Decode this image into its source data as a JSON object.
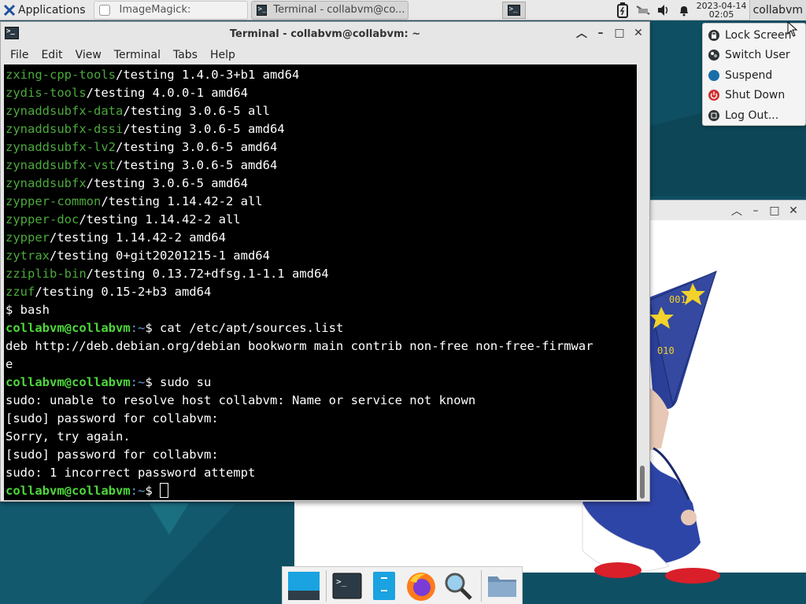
{
  "colors": {
    "desktop": "#0f4f63",
    "prompt": "#4dd83a",
    "package": "#4ca93c",
    "path": "#6b9fd8"
  },
  "panel": {
    "applications_label": "Applications",
    "tasks": [
      {
        "label": "ImageMagick:",
        "icon": "imagemagick-icon"
      },
      {
        "label": "Terminal - collabvm@co...",
        "icon": "terminal-icon"
      }
    ],
    "clock_date": "2023-04-14",
    "clock_time": "02:05",
    "user_label": "collabvm"
  },
  "session_menu": {
    "items": [
      "Lock Screen",
      "Switch User",
      "Suspend",
      "Shut Down",
      "Log Out..."
    ]
  },
  "terminal": {
    "title": "Terminal - collabvm@collabvm: ~",
    "menu": [
      "File",
      "Edit",
      "View",
      "Terminal",
      "Tabs",
      "Help"
    ],
    "packages": [
      {
        "name": "zxing-cpp-tools",
        "rest": "/testing 1.4.0-3+b1 amd64"
      },
      {
        "name": "zydis-tools",
        "rest": "/testing 4.0.0-1 amd64"
      },
      {
        "name": "zynaddsubfx-data",
        "rest": "/testing 3.0.6-5 all"
      },
      {
        "name": "zynaddsubfx-dssi",
        "rest": "/testing 3.0.6-5 amd64"
      },
      {
        "name": "zynaddsubfx-lv2",
        "rest": "/testing 3.0.6-5 amd64"
      },
      {
        "name": "zynaddsubfx-vst",
        "rest": "/testing 3.0.6-5 amd64"
      },
      {
        "name": "zynaddsubfx",
        "rest": "/testing 3.0.6-5 amd64"
      },
      {
        "name": "zypper-common",
        "rest": "/testing 1.14.42-2 all"
      },
      {
        "name": "zypper-doc",
        "rest": "/testing 1.14.42-2 all"
      },
      {
        "name": "zypper",
        "rest": "/testing 1.14.42-2 amd64"
      },
      {
        "name": "zytrax",
        "rest": "/testing 0+git20201215-1 amd64"
      },
      {
        "name": "zziplib-bin",
        "rest": "/testing 0.13.72+dfsg.1-1.1 amd64"
      },
      {
        "name": "zzuf",
        "rest": "/testing 0.15-2+b3 amd64"
      }
    ],
    "bash_line": "$ bash",
    "prompt_user": "collabvm@collabvm",
    "prompt_path": ":~",
    "prompt_sym": "$ ",
    "cmd1": "cat /etc/apt/sources.list",
    "sources_line1": "deb http://deb.debian.org/debian bookworm main contrib non-free non-free-firmwar",
    "sources_line2": "e",
    "cmd2": "sudo su",
    "out1": "sudo: unable to resolve host collabvm: Name or service not known",
    "out2": "[sudo] password for collabvm:",
    "out3": "Sorry, try again.",
    "out4": "[sudo] password for collabvm:",
    "out5": "sudo: 1 incorrect password attempt"
  },
  "dock": {
    "items": [
      "show-desktop-icon",
      "terminal-icon",
      "file-manager-icon",
      "firefox-icon",
      "search-icon",
      "folder-icon"
    ]
  }
}
